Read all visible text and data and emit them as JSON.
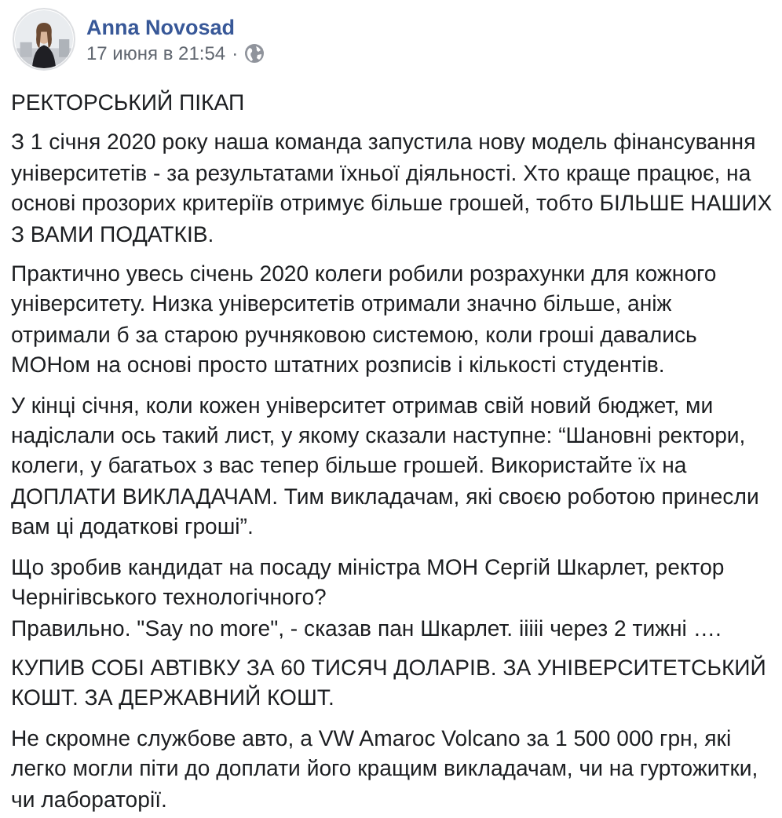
{
  "post": {
    "author": "Anna Novosad",
    "timestamp": "17 июня в 21:54",
    "separator": "·",
    "paragraphs": [
      {
        "lines": [
          "РЕКТОРСЬКИЙ ПІКАП"
        ]
      },
      {
        "lines": [
          "З 1 січня 2020 року наша команда запустила нову модель фінансування університетів - за результатами їхньої діяльності. Хто краще працює, на основі прозорих критеріїв отримує більше грошей, тобто БІЛЬШЕ НАШИХ З ВАМИ ПОДАТКІВ."
        ]
      },
      {
        "lines": [
          "Практично увесь січень 2020 колеги робили розрахунки для кожного університету. Низка університетів отримали значно більше, аніж отримали б за старою ручняковою системою, коли гроші давались МОНом на основі просто штатних розписів і кількості студентів."
        ]
      },
      {
        "lines": [
          "У кінці січня, коли кожен університет отримав свій новий бюджет, ми надіслали ось такий лист, у якому сказали наступне: “Шановні ректори, колеги, у багатьох з вас тепер більше грошей. Використайте їх на ДОПЛАТИ ВИКЛАДАЧАМ. Тим викладачам, які своєю роботою принесли вам ці додаткові гроші”."
        ]
      },
      {
        "lines": [
          "Що зробив кандидат на посаду міністра МОН Сергій Шкарлет, ректор Чернігівського технологічного?",
          "Правильно. \"Say no more\", - сказав пан Шкарлет. ііііі через 2 тижні …."
        ]
      },
      {
        "lines": [
          "КУПИВ СОБІ АВТІВКУ ЗА 60 ТИСЯЧ ДОЛАРІВ. ЗА УНІВЕРСИТЕТСЬКИЙ КОШТ. ЗА ДЕРЖАВНИЙ КОШТ."
        ]
      },
      {
        "lines": [
          "Не скромне службове авто, а VW Amaroc Volcano за 1 500 000 грн, які легко могли піти до доплати його кращим викладачам, чи на гуртожитки, чи лабораторії."
        ]
      }
    ]
  }
}
